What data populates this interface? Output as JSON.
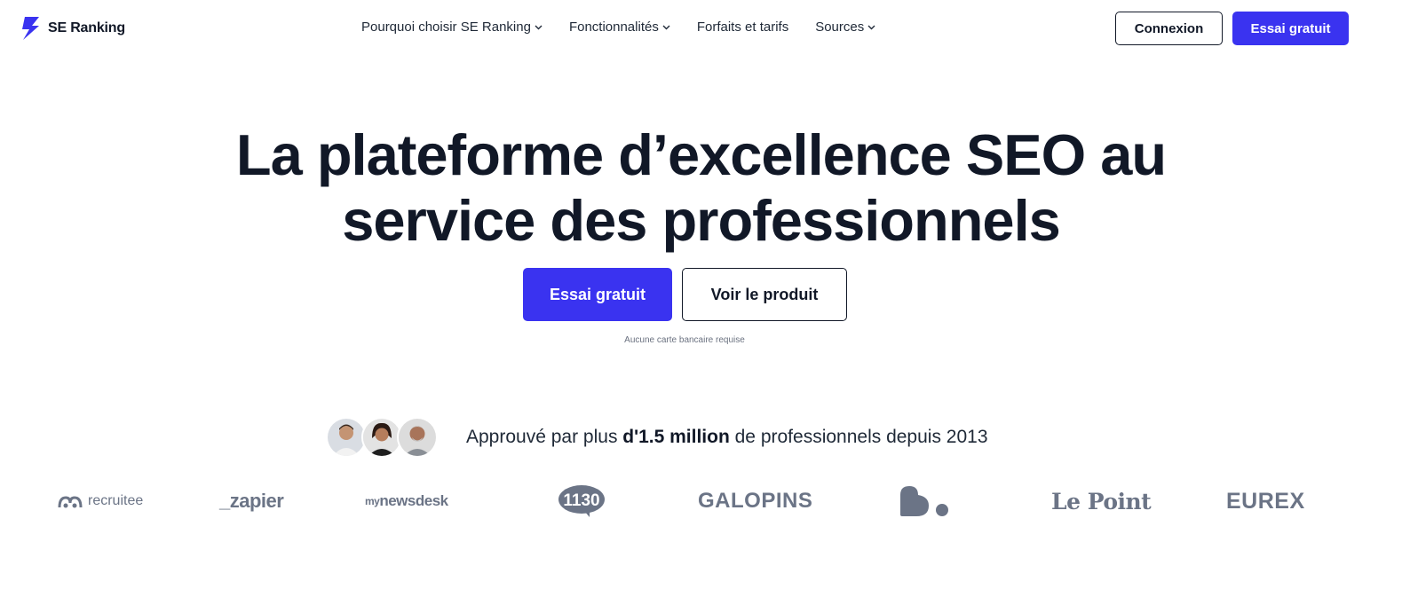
{
  "header": {
    "logo_text": "SE Ranking",
    "nav": [
      {
        "label": "Pourquoi choisir SE Ranking",
        "has_dropdown": true
      },
      {
        "label": "Fonctionnalités",
        "has_dropdown": true
      },
      {
        "label": "Forfaits et tarifs",
        "has_dropdown": false
      },
      {
        "label": "Sources",
        "has_dropdown": true
      }
    ],
    "login_label": "Connexion",
    "trial_label": "Essai gratuit"
  },
  "hero": {
    "title_line1": "La plateforme d’excellence SEO au",
    "title_line2": "service des professionnels",
    "primary_cta": "Essai gratuit",
    "secondary_cta": "Voir le produit",
    "note": "Aucune carte bancaire requise"
  },
  "proof": {
    "text_before": "Approuvé par plus ",
    "text_bold": "d'1.5 million",
    "text_after": " de professionnels depuis 2013"
  },
  "logos": {
    "recruitee": "recruitee",
    "zapier": "_zapier",
    "mynewsdesk_prefix": "my",
    "mynewsdesk_main": "newsdesk",
    "onethirty": "1130",
    "galopins": "GALOPINS",
    "lepoint": "Le Point",
    "eurex": "EUREX"
  },
  "colors": {
    "accent": "#3a33f0",
    "text": "#111827",
    "logo_gray": "#6b7486"
  }
}
